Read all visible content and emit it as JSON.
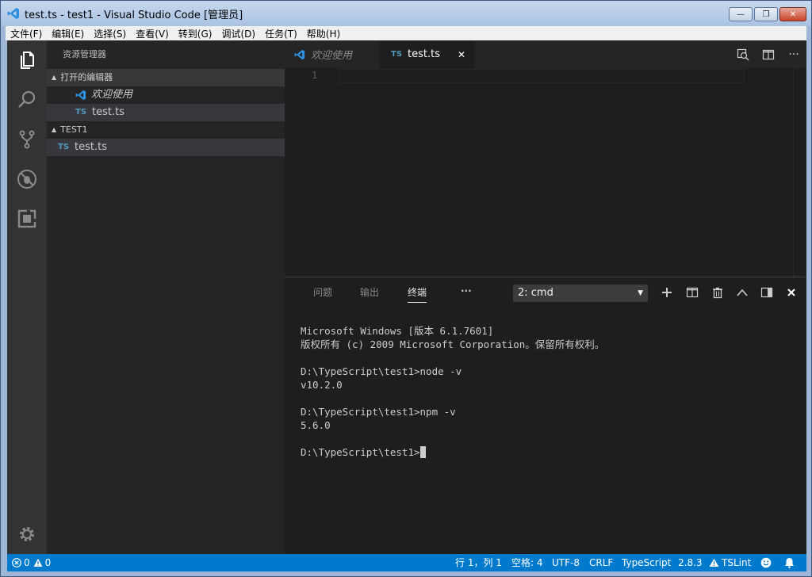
{
  "window": {
    "title": "test.ts - test1 - Visual Studio Code [管理员]",
    "minimize": "—",
    "maximize": "❐",
    "close": "✕"
  },
  "menu": [
    "文件(F)",
    "编辑(E)",
    "选择(S)",
    "查看(V)",
    "转到(G)",
    "调试(D)",
    "任务(T)",
    "帮助(H)"
  ],
  "sidebar": {
    "title": "资源管理器",
    "open_editors_header": "打开的编辑器",
    "open_editors": [
      {
        "label": "欢迎使用",
        "icon": "vscode-icon"
      },
      {
        "label": "test.ts",
        "icon": "TS"
      }
    ],
    "folder_header": "TEST1",
    "files": [
      {
        "label": "test.ts",
        "icon": "TS"
      }
    ]
  },
  "editor": {
    "tabs": [
      {
        "label": "欢迎使用",
        "icon": "vscode-icon"
      },
      {
        "label": "test.ts",
        "icon": "TS",
        "close": "✕"
      }
    ],
    "line_numbers": [
      "1"
    ]
  },
  "panel": {
    "tabs": [
      "问题",
      "输出",
      "终端"
    ],
    "more": "···",
    "terminal_select": "2: cmd",
    "terminal_lines": [
      "Microsoft Windows [版本 6.1.7601]",
      "版权所有 (c) 2009 Microsoft Corporation。保留所有权利。",
      "",
      "D:\\TypeScript\\test1>node -v",
      "v10.2.0",
      "",
      "D:\\TypeScript\\test1>npm -v",
      "5.6.0",
      "",
      "D:\\TypeScript\\test1>"
    ]
  },
  "status": {
    "errors": "0",
    "warnings": "0",
    "position": "行 1，列 1",
    "indent": "空格: 4",
    "encoding": "UTF-8",
    "eol": "CRLF",
    "language": "TypeScript",
    "version": "2.8.3",
    "tslint": "TSLint"
  },
  "colors": {
    "accent": "#007acc",
    "ts_icon": "#519aba",
    "vscode_icon": "#2d8fdd"
  }
}
